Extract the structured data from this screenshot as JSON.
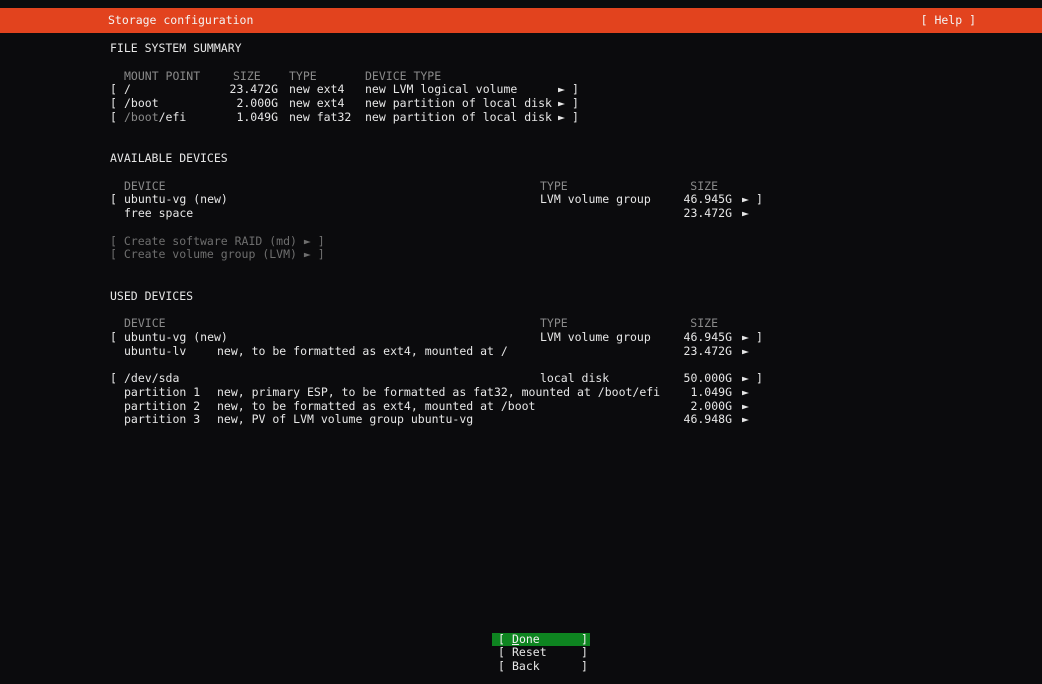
{
  "colors": {
    "bg": "#0b0b0d",
    "orange": "#e2431e",
    "green": "#0e8420",
    "text": "#e7e7e7",
    "dim": "#8a8a8a",
    "disabled": "#6e6e6e"
  },
  "glyphs": {
    "open": "[",
    "close": "]",
    "arrow": "►"
  },
  "header": {
    "title": "Storage configuration",
    "help": "[ Help ]"
  },
  "fs_summary": {
    "title": "FILE SYSTEM SUMMARY",
    "headers": {
      "mount": "MOUNT POINT",
      "size": "SIZE",
      "type": "TYPE",
      "device_type": "DEVICE TYPE"
    },
    "rows": [
      {
        "prefix": "",
        "mount": "/",
        "size": "23.472G",
        "type": "new ext4",
        "device_type": "new LVM logical volume"
      },
      {
        "prefix": "",
        "mount": "/boot",
        "size": "2.000G",
        "type": "new ext4",
        "device_type": "new partition of local disk"
      },
      {
        "prefix": "/boot",
        "mount": "/efi",
        "size": "1.049G",
        "type": "new fat32",
        "device_type": "new partition of local disk"
      }
    ]
  },
  "available": {
    "title": "AVAILABLE DEVICES",
    "headers": {
      "device": "DEVICE",
      "type": "TYPE",
      "size": "SIZE"
    },
    "rows": [
      {
        "device": "ubuntu-vg (new)",
        "type": "LVM volume group",
        "size": "46.945G"
      },
      {
        "device": "free space",
        "type": "",
        "size": "23.472G"
      }
    ],
    "actions": [
      "[ Create software RAID (md) ► ]",
      "[ Create volume group (LVM) ► ]"
    ]
  },
  "used": {
    "title": "USED DEVICES",
    "headers": {
      "device": "DEVICE",
      "type": "TYPE",
      "size": "SIZE"
    },
    "groups": [
      {
        "device": "ubuntu-vg (new)",
        "type": "LVM volume group",
        "size": "46.945G",
        "children": [
          {
            "name": "ubuntu-lv",
            "desc": "new, to be formatted as ext4, mounted at /",
            "size": "23.472G"
          }
        ]
      },
      {
        "device": "/dev/sda",
        "type": "local disk",
        "size": "50.000G",
        "children": [
          {
            "name": "partition 1",
            "desc": "new, primary ESP, to be formatted as fat32, mounted at /boot/efi",
            "size": "1.049G"
          },
          {
            "name": "partition 2",
            "desc": "new, to be formatted as ext4, mounted at /boot",
            "size": "2.000G"
          },
          {
            "name": "partition 3",
            "desc": "new, PV of LVM volume group ubuntu-vg",
            "size": "46.948G"
          }
        ]
      }
    ]
  },
  "buttons": {
    "done": "Done",
    "reset": "Reset",
    "back": "Back"
  }
}
